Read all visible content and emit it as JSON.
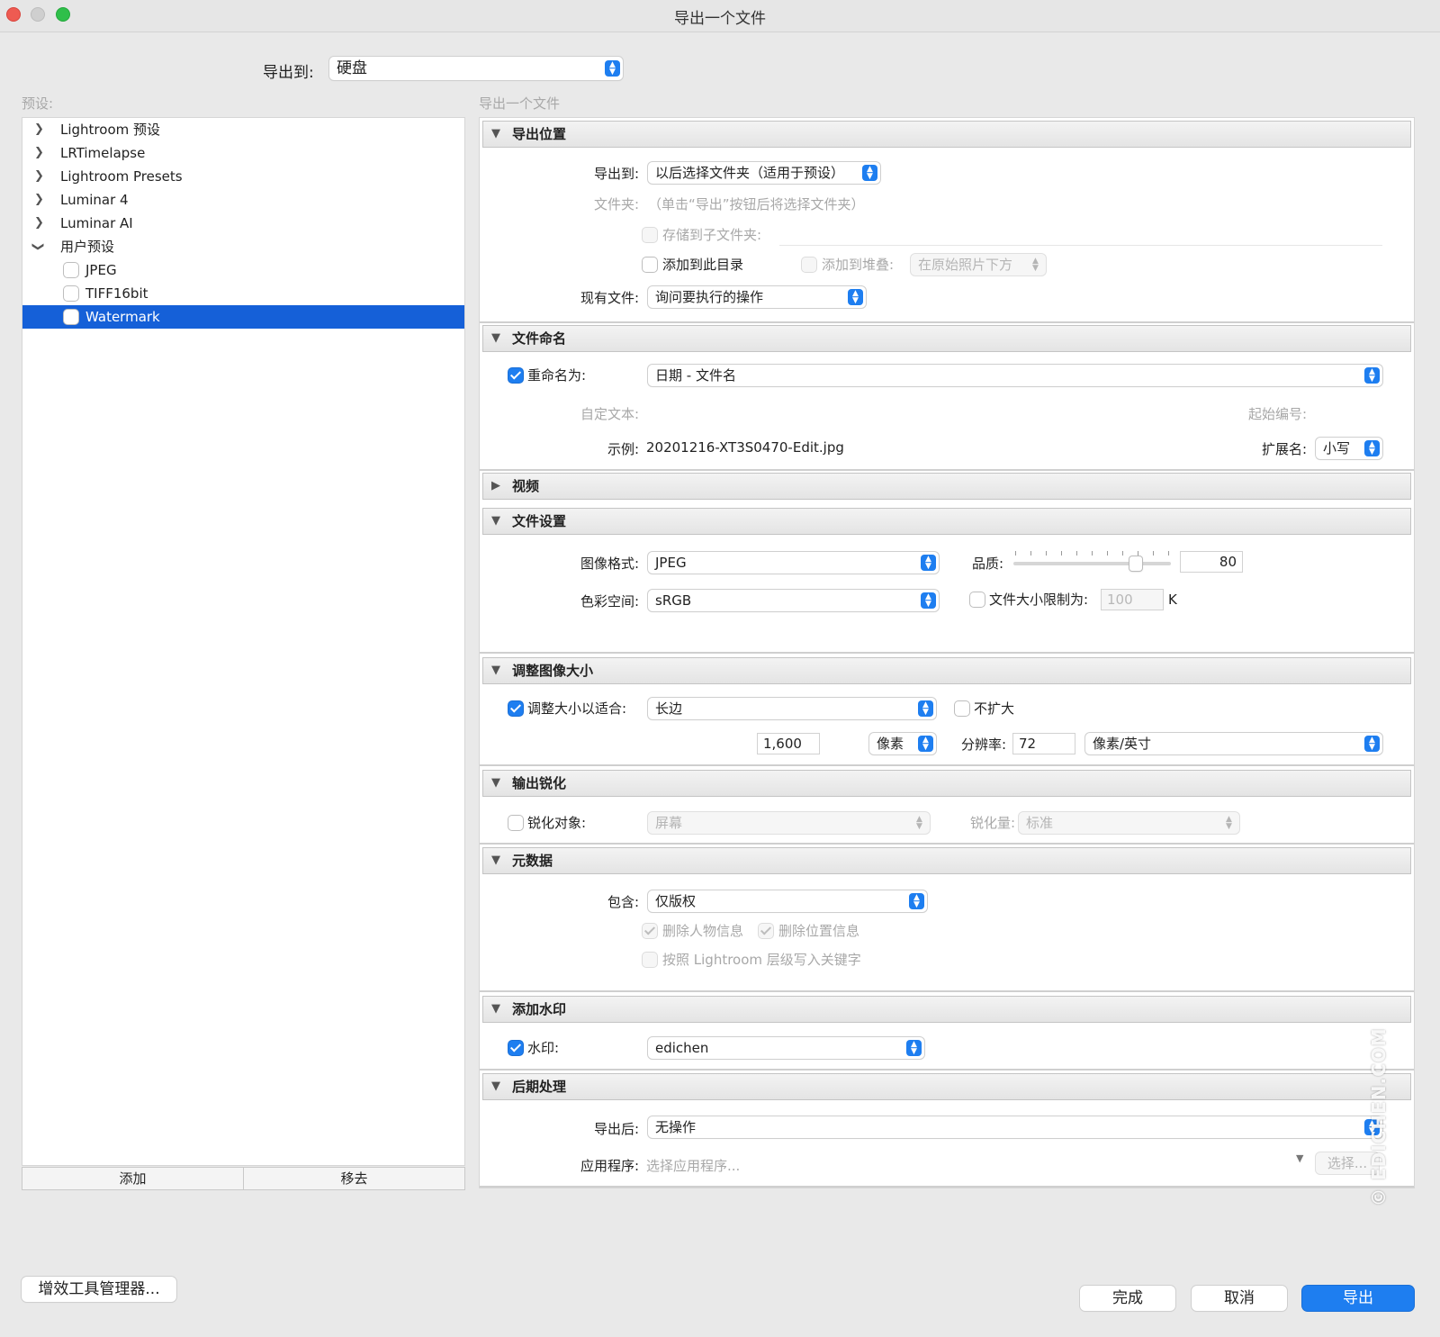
{
  "window": {
    "title": "导出一个文件"
  },
  "export_to": {
    "label": "导出到:",
    "value": "硬盘"
  },
  "presets": {
    "label": "预设:",
    "items": [
      {
        "label": "Lightroom 预设",
        "expanded": false
      },
      {
        "label": "LRTimelapse",
        "expanded": false
      },
      {
        "label": "Lightroom Presets",
        "expanded": false
      },
      {
        "label": "Luminar 4",
        "expanded": false
      },
      {
        "label": "Luminar AI",
        "expanded": false
      },
      {
        "label": "用户预设",
        "expanded": true,
        "children": [
          {
            "label": "JPEG",
            "selected": false
          },
          {
            "label": "TIFF16bit",
            "selected": false
          },
          {
            "label": "Watermark",
            "selected": true
          }
        ]
      }
    ],
    "add_button": "添加",
    "remove_button": "移去"
  },
  "content_title": "导出一个文件",
  "sections": {
    "export_location": {
      "title": "导出位置",
      "export_to_label": "导出到:",
      "export_to_value": "以后选择文件夹（适用于预设）",
      "folder_label": "文件夹:",
      "folder_value": "（单击“导出”按钮后将选择文件夹）",
      "subfolder_label": "存储到子文件夹:",
      "add_catalog_label": "添加到此目录",
      "add_stack_label": "添加到堆叠:",
      "stack_position": "在原始照片下方",
      "existing_label": "现有文件:",
      "existing_value": "询问要执行的操作"
    },
    "file_naming": {
      "title": "文件命名",
      "rename_label": "重命名为:",
      "rename_value": "日期 - 文件名",
      "custom_text_label": "自定文本:",
      "start_number_label": "起始编号:",
      "example_label": "示例:",
      "example_value": "20201216-XT3S0470-Edit.jpg",
      "extension_label": "扩展名:",
      "extension_value": "小写"
    },
    "video": {
      "title": "视频"
    },
    "file_settings": {
      "title": "文件设置",
      "format_label": "图像格式:",
      "format_value": "JPEG",
      "quality_label": "品质:",
      "quality_value": "80",
      "quality_level": 80,
      "colorspace_label": "色彩空间:",
      "colorspace_value": "sRGB",
      "limit_label": "文件大小限制为:",
      "limit_value": "100",
      "limit_unit": "K"
    },
    "resize": {
      "title": "调整图像大小",
      "fit_label": "调整大小以适合:",
      "fit_value": "长边",
      "no_enlarge_label": "不扩大",
      "size_value": "1,600",
      "size_unit": "像素",
      "resolution_label": "分辨率:",
      "resolution_value": "72",
      "resolution_unit": "像素/英寸"
    },
    "sharpening": {
      "title": "输出锐化",
      "sharpen_label": "锐化对象:",
      "sharpen_for": "屏幕",
      "amount_label": "锐化量:",
      "amount_value": "标准"
    },
    "metadata": {
      "title": "元数据",
      "include_label": "包含:",
      "include_value": "仅版权",
      "remove_person_label": "删除人物信息",
      "remove_location_label": "删除位置信息",
      "hierarchy_label": "按照 Lightroom 层级写入关键字"
    },
    "watermark": {
      "title": "添加水印",
      "watermark_label": "水印:",
      "watermark_value": "edichen"
    },
    "post_processing": {
      "title": "后期处理",
      "after_label": "导出后:",
      "after_value": "无操作",
      "app_label": "应用程序:",
      "app_placeholder": "选择应用程序...",
      "choose_button": "选择..."
    }
  },
  "footer": {
    "plugin_manager": "增效工具管理器...",
    "done": "完成",
    "cancel": "取消",
    "export": "导出"
  },
  "image_watermark": "© EDICHEN.COM",
  "colors": {
    "accent": "#1e7ef0",
    "selection": "#1560d8",
    "close": "#ee5b52",
    "zoom": "#2fbf4a"
  }
}
